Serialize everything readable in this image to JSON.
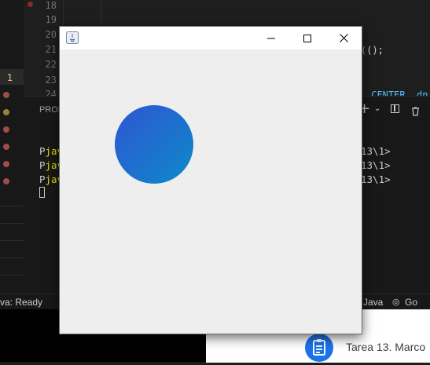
{
  "editor": {
    "line_numbers": [
      "18",
      "19",
      "20",
      "21",
      "22",
      "1",
      "23",
      "24"
    ],
    "code_snippets": {
      "call_suffix": "();",
      "center_text": ".CENTER, dn"
    }
  },
  "panel": {
    "tab_label": "PROB",
    "terminal_lines": [
      {
        "prefix": "P",
        "cmd": "jav",
        "suffix": "13\\1>"
      },
      {
        "prefix": "P",
        "cmd": "jav",
        "suffix": "13\\1>"
      },
      {
        "prefix": "P",
        "cmd": "jav",
        "suffix": "13\\1>"
      }
    ]
  },
  "statusbar": {
    "left_text": "va: Ready",
    "lang": "Java",
    "golive": "Go Liv"
  },
  "browser": {
    "item_title": "Tarea 13. Marco"
  },
  "java_window": {
    "circle_gradient_start": "#2f55d4",
    "circle_gradient_end": "#0e8ac8",
    "background": "#eeeeee"
  }
}
